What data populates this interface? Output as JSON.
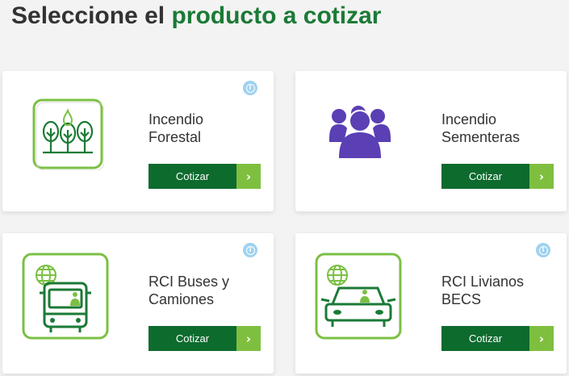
{
  "page": {
    "title_prefix": "Seleccione el",
    "title_highlight": "producto a cotizar"
  },
  "colors": {
    "brand_green": "#1b7a36",
    "button_dark_green": "#0d6b2e",
    "button_arrow_green": "#7fbf3f",
    "icon_light_green": "#7bc043",
    "people_purple": "#5b3fb4",
    "info_blue": "#9fd2ef"
  },
  "products": [
    {
      "name_line1": "Incendio",
      "name_line2": "Forestal",
      "button_label": "Cotizar",
      "icon": "forest-fire-icon",
      "has_info": true
    },
    {
      "name_line1": "Incendio",
      "name_line2": "Sementeras",
      "button_label": "Cotizar",
      "icon": "people-group-icon",
      "has_info": false
    },
    {
      "name_line1": "RCI Buses y",
      "name_line2": "Camiones",
      "button_label": "Cotizar",
      "icon": "bus-globe-icon",
      "has_info": true
    },
    {
      "name_line1": "RCI Livianos",
      "name_line2": "BECS",
      "button_label": "Cotizar",
      "icon": "car-globe-icon",
      "has_info": true
    }
  ],
  "info_icon_glyph": "i",
  "arrow_glyph": "›"
}
